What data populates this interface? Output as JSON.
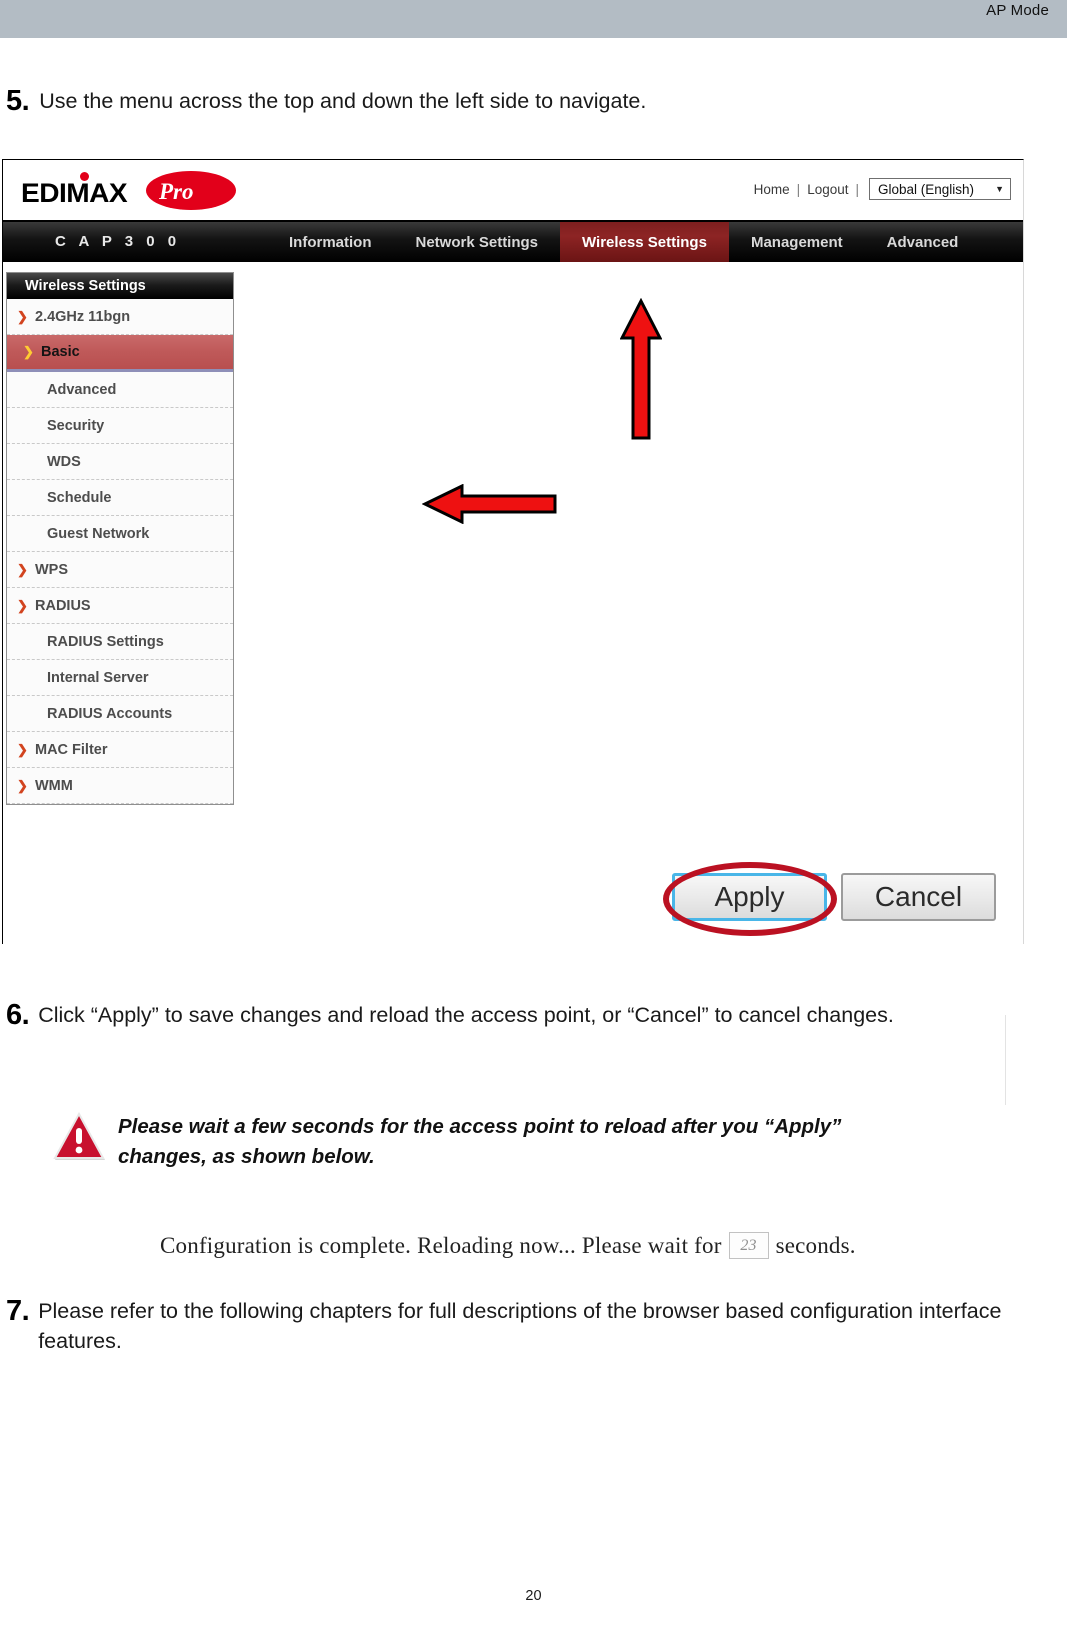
{
  "page": {
    "mode_label": "AP Mode",
    "number": "20"
  },
  "steps": [
    {
      "num": "5.",
      "text": "Use the menu across the top and down the left side to navigate."
    },
    {
      "num": "6.",
      "text": "Click “Apply” to save changes and reload the access point, or “Cancel” to cancel changes."
    },
    {
      "num": "7.",
      "text": "Please refer to the following chapters for full descriptions of the browser based configuration interface features."
    }
  ],
  "router_ui": {
    "logo": {
      "brand": "EDIMAX",
      "suffix": "Pro"
    },
    "top_links": {
      "home": "Home",
      "separator": "|",
      "logout": "Logout",
      "language": "Global (English)",
      "caret": "▼"
    },
    "model": "C A P 3 0 0",
    "nav": [
      {
        "label": "Information",
        "active": false
      },
      {
        "label": "Network Settings",
        "active": false
      },
      {
        "label": "Wireless Settings",
        "active": true
      },
      {
        "label": "Management",
        "active": false
      },
      {
        "label": "Advanced",
        "active": false
      }
    ],
    "sidebar": {
      "title": "Wireless Settings",
      "items": [
        {
          "label": "2.4GHz 11bgn",
          "level": "top",
          "arrow": "❯",
          "selected": false
        },
        {
          "label": "Basic",
          "level": "child",
          "arrow": "❯",
          "selected": true
        },
        {
          "label": "Advanced",
          "level": "child",
          "arrow": "",
          "selected": false
        },
        {
          "label": "Security",
          "level": "child",
          "arrow": "",
          "selected": false
        },
        {
          "label": "WDS",
          "level": "child",
          "arrow": "",
          "selected": false
        },
        {
          "label": "Schedule",
          "level": "child",
          "arrow": "",
          "selected": false
        },
        {
          "label": "Guest Network",
          "level": "child",
          "arrow": "",
          "selected": false
        },
        {
          "label": "WPS",
          "level": "top",
          "arrow": "❯",
          "selected": false
        },
        {
          "label": "RADIUS",
          "level": "top",
          "arrow": "❯",
          "selected": false
        },
        {
          "label": "RADIUS Settings",
          "level": "child",
          "arrow": "",
          "selected": false
        },
        {
          "label": "Internal Server",
          "level": "child",
          "arrow": "",
          "selected": false
        },
        {
          "label": "RADIUS Accounts",
          "level": "child",
          "arrow": "",
          "selected": false
        },
        {
          "label": "MAC Filter",
          "level": "top",
          "arrow": "❯",
          "selected": false
        },
        {
          "label": "WMM",
          "level": "top",
          "arrow": "❯",
          "selected": false
        }
      ]
    },
    "buttons": {
      "apply": "Apply",
      "cancel": "Cancel"
    }
  },
  "warning": {
    "text": "Please wait a few seconds for the access point to reload after you “Apply” changes, as shown below."
  },
  "reload_status": {
    "prefix": "Configuration is complete. Reloading now... Please wait for",
    "seconds_value": "23",
    "suffix": "seconds."
  },
  "colors": {
    "header_band": "#b3bcc4",
    "accent_red": "#e2001a",
    "nav_active": "#8d2424",
    "sidebar_selected": "#bf5959",
    "annotation_red": "#ee1111",
    "highlight_ring": "#bb1122",
    "apply_focus": "#49b6e8"
  }
}
